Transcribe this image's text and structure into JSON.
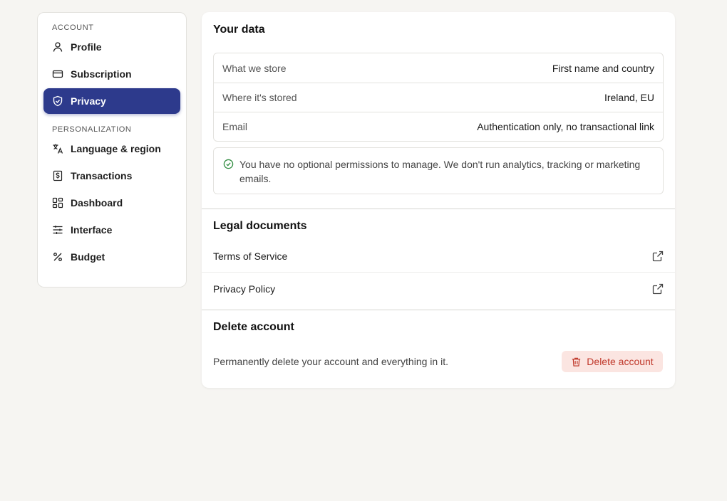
{
  "sidebar": {
    "account_heading": "ACCOUNT",
    "personalization_heading": "PERSONALIZATION",
    "account_items": [
      {
        "label": "Profile",
        "icon": "user-icon"
      },
      {
        "label": "Subscription",
        "icon": "credit-card-icon"
      },
      {
        "label": "Privacy",
        "icon": "shield-check-icon",
        "active": true
      }
    ],
    "personalization_items": [
      {
        "label": "Language & region",
        "icon": "translate-icon"
      },
      {
        "label": "Transactions",
        "icon": "receipt-dollar-icon"
      },
      {
        "label": "Dashboard",
        "icon": "grid-icon"
      },
      {
        "label": "Interface",
        "icon": "sliders-icon"
      },
      {
        "label": "Budget",
        "icon": "percent-icon"
      }
    ]
  },
  "your_data": {
    "title": "Your data",
    "rows": [
      {
        "key": "What we store",
        "value": "First name and country"
      },
      {
        "key": "Where it's stored",
        "value": "Ireland, EU"
      },
      {
        "key": "Email",
        "value": "Authentication only, no transactional link"
      }
    ],
    "notice": "You have no optional permissions to manage. We don't run analytics, tracking or marketing emails."
  },
  "legal": {
    "title": "Legal documents",
    "links": [
      {
        "label": "Terms of Service"
      },
      {
        "label": "Privacy Policy"
      }
    ]
  },
  "delete": {
    "title": "Delete account",
    "description": "Permanently delete your account and everything in it.",
    "button_label": "Delete account"
  },
  "colors": {
    "accent": "#2d3a8c",
    "danger_text": "#c0392b",
    "danger_bg": "#fbe5e1",
    "success": "#2e8b3e",
    "page_bg": "#f6f5f2"
  }
}
